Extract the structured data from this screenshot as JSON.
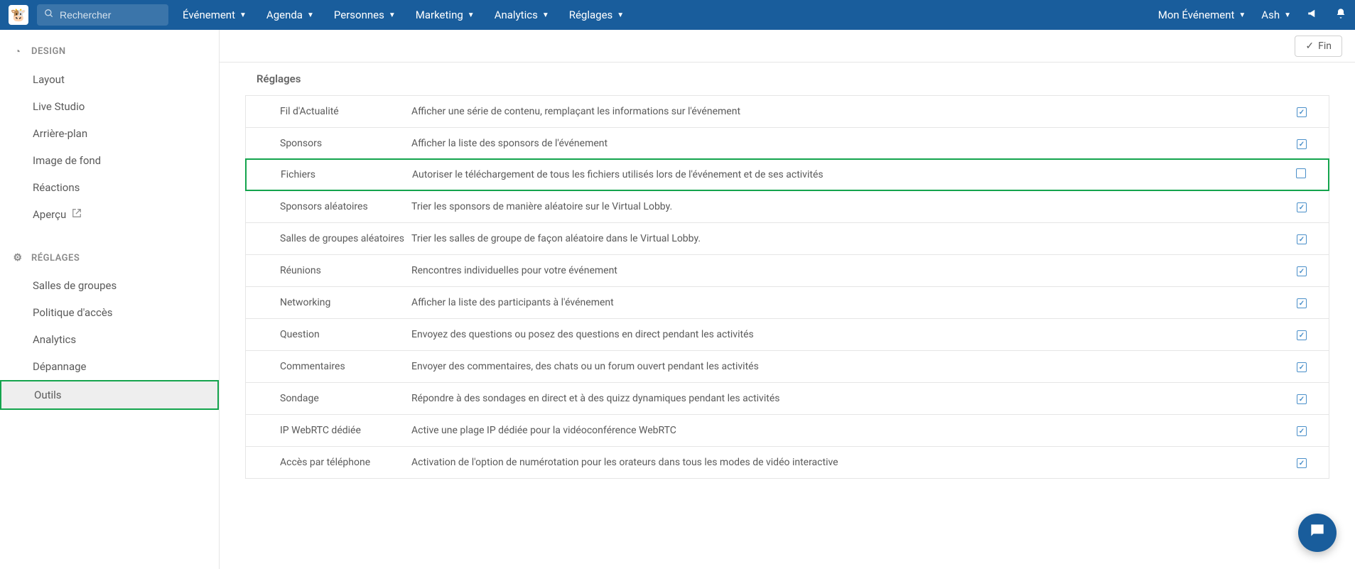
{
  "topbar": {
    "search_placeholder": "Rechercher",
    "nav": [
      "Événement",
      "Agenda",
      "Personnes",
      "Marketing",
      "Analytics",
      "Réglages"
    ],
    "event_label": "Mon Événement",
    "user_label": "Ash"
  },
  "sidebar": {
    "design_hdr": "DESIGN",
    "design_items": [
      "Layout",
      "Live Studio",
      "Arrière-plan",
      "Image de fond",
      "Réactions",
      "Aperçu"
    ],
    "settings_hdr": "RÉGLAGES",
    "settings_items": [
      "Salles de groupes",
      "Politique d'accès",
      "Analytics",
      "Dépannage",
      "Outils"
    ]
  },
  "actions": {
    "fin_label": "Fin"
  },
  "panel": {
    "title": "Réglages",
    "rows": [
      {
        "name": "Fil d'Actualité",
        "desc": "Afficher une série de contenu, remplaçant les informations sur l'événement",
        "checked": true,
        "highlight": false
      },
      {
        "name": "Sponsors",
        "desc": "Afficher la liste des sponsors de l'événement",
        "checked": true,
        "highlight": false
      },
      {
        "name": "Fichiers",
        "desc": "Autoriser le téléchargement de tous les fichiers utilisés lors de l'événement et de ses activités",
        "checked": false,
        "highlight": true
      },
      {
        "name": "Sponsors aléatoires",
        "desc": "Trier les sponsors de manière aléatoire sur le Virtual Lobby.",
        "checked": true,
        "highlight": false
      },
      {
        "name": "Salles de groupes aléatoires",
        "desc": "Trier les salles de groupe de façon aléatoire dans le Virtual Lobby.",
        "checked": true,
        "highlight": false
      },
      {
        "name": "Réunions",
        "desc": "Rencontres individuelles pour votre événement",
        "checked": true,
        "highlight": false
      },
      {
        "name": "Networking",
        "desc": "Afficher la liste des participants à l'événement",
        "checked": true,
        "highlight": false
      },
      {
        "name": "Question",
        "desc": "Envoyez des questions ou posez des questions en direct pendant les activités",
        "checked": true,
        "highlight": false
      },
      {
        "name": "Commentaires",
        "desc": "Envoyer des commentaires, des chats ou un forum ouvert pendant les activités",
        "checked": true,
        "highlight": false
      },
      {
        "name": "Sondage",
        "desc": "Répondre à des sondages en direct et à des quizz dynamiques pendant les activités",
        "checked": true,
        "highlight": false
      },
      {
        "name": "IP WebRTC dédiée",
        "desc": "Active une plage IP dédiée pour la vidéoconférence WebRTC",
        "checked": true,
        "highlight": false
      },
      {
        "name": "Accès par téléphone",
        "desc": "Activation de l'option de numérotation pour les orateurs dans tous les modes de vidéo interactive",
        "checked": true,
        "highlight": false
      }
    ]
  }
}
